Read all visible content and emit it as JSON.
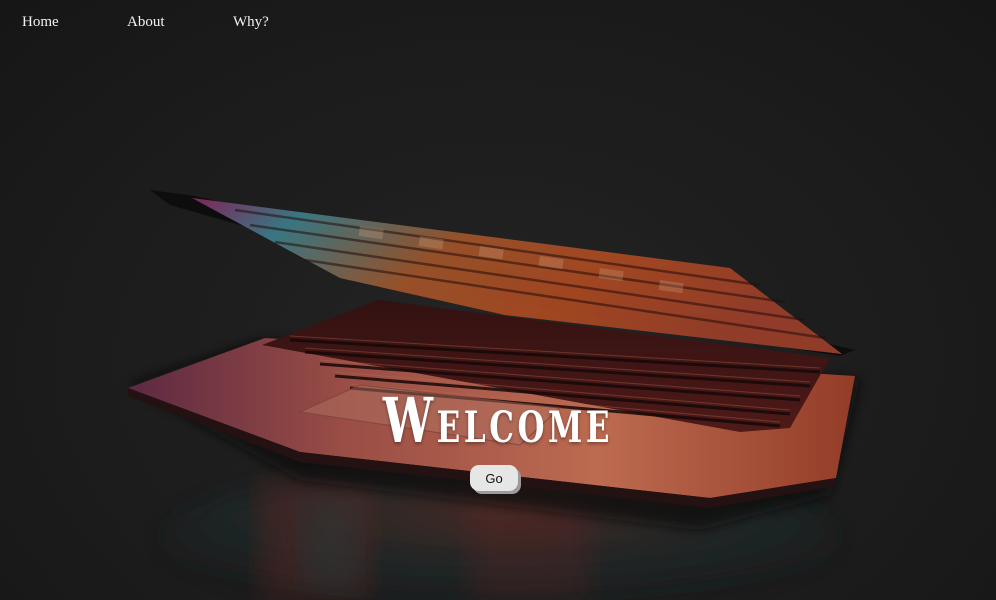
{
  "nav": {
    "items": [
      {
        "label": "Home"
      },
      {
        "label": "About"
      },
      {
        "label": "Why?"
      }
    ]
  },
  "hero": {
    "heading": "Welcome",
    "button_label": "Go",
    "background_icon": "laptop-icon"
  },
  "colors": {
    "background": "#222222",
    "text": "#ffffff",
    "button": "#e6e6e6"
  }
}
